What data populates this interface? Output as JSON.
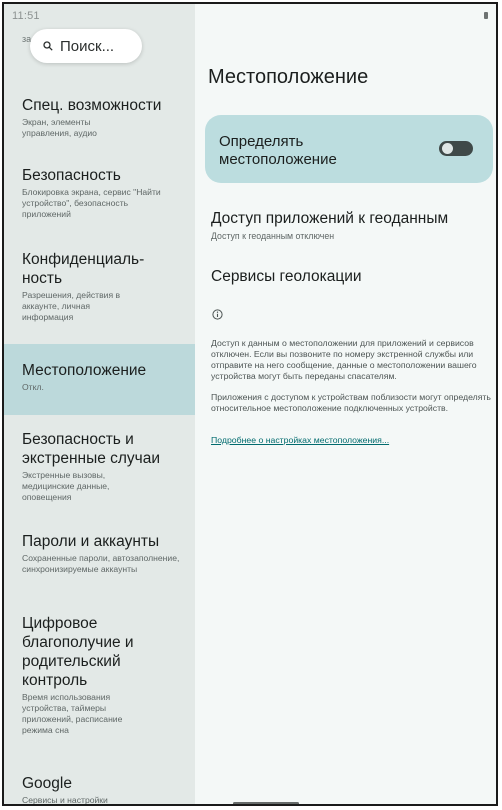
{
  "status_bar": {
    "time": "11:51"
  },
  "search": {
    "label": "Поиск..."
  },
  "sidebar": {
    "clipped_item_sub": "за...",
    "items": [
      {
        "title": "Спец. возможности",
        "subtitle": "Экран, элементы управления, аудио",
        "selected": false
      },
      {
        "title": "Безопасность",
        "subtitle": "Блокировка экрана, сервис \"Найти устройство\", безопасность приложений",
        "selected": false
      },
      {
        "title": "Конфиденциаль-ность",
        "subtitle": "Разрешения, действия в аккаунте, личная информация",
        "selected": false
      },
      {
        "title": "Местоположение",
        "subtitle": "Откл.",
        "selected": true
      },
      {
        "title": "Безопасность и экстренные случаи",
        "subtitle": "Экстренные вызовы, медицинские данные, оповещения",
        "selected": false
      },
      {
        "title": "Пароли и аккаунты",
        "subtitle": "Сохраненные пароли, автозаполнение, синхронизируемые аккаунты",
        "selected": false
      },
      {
        "title": "Цифровое благополучие и родительский контроль",
        "subtitle": "Время использования устройства, таймеры приложений, расписание режима сна",
        "selected": false
      },
      {
        "title": "Google",
        "subtitle": "Сервисы и настройки",
        "selected": false
      }
    ]
  },
  "main": {
    "title": "Местоположение",
    "toggle": {
      "label": "Определять местоположение",
      "state": "off"
    },
    "app_access": {
      "title": "Доступ приложений к геоданным",
      "subtitle": "Доступ к геоданным отключен"
    },
    "services": {
      "title": "Сервисы геолокации"
    },
    "info_paragraph_1": "Доступ к данным о местоположении для приложений и сервисов отключен. Если вы позвоните по номеру экстренной службы или отправите на него сообщение, данные о местоположении вашего устройства могут быть переданы спасателям.",
    "info_paragraph_2": "Приложения с доступом к устройствам поблизости могут определять относительное местоположение подключенных устройств.",
    "learn_more_link": "Подробнее о настройках местоположения..."
  },
  "colors": {
    "sidebar_bg": "#e3e9e7",
    "selected_bg": "#bcd9db",
    "card_bg": "#bcdddf",
    "link": "#006b6e"
  }
}
